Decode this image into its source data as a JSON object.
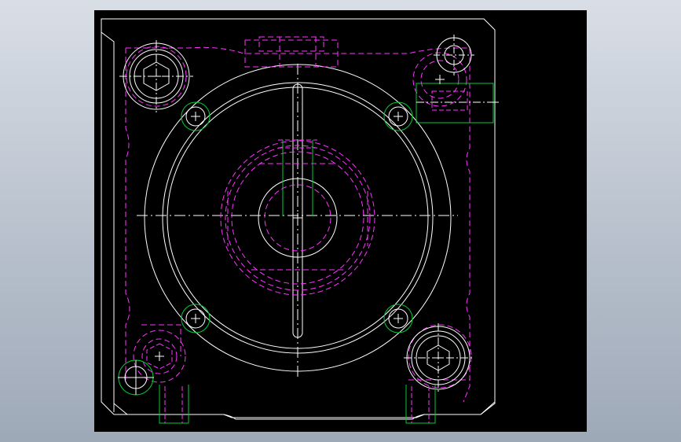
{
  "app": {
    "title": "",
    "viewport_background": "#000000",
    "window_background": "#c3cad5"
  },
  "drawing": {
    "layers": [
      {
        "name": "outline",
        "color": "#ffffff",
        "linetype": "continuous"
      },
      {
        "name": "hidden",
        "color": "#ff33ff",
        "linetype": "dashed"
      },
      {
        "name": "holes",
        "color": "#00cc33",
        "linetype": "continuous"
      },
      {
        "name": "centerline",
        "color": "#ffffff",
        "linetype": "dash-dot"
      }
    ],
    "annotations": []
  }
}
